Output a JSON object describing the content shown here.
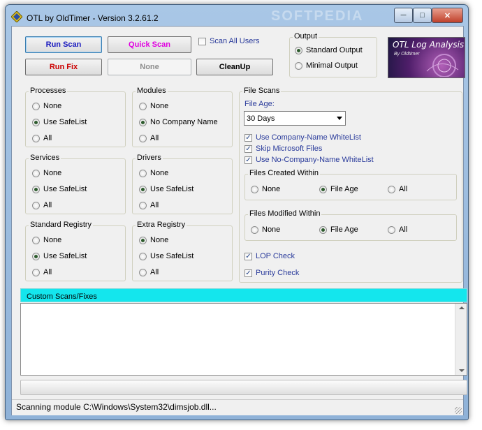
{
  "window": {
    "title": "OTL by OldTimer - Version 3.2.61.2",
    "watermark": "SOFTPEDIA",
    "controls": {
      "minimize": "─",
      "maximize": "□",
      "close": "✕"
    }
  },
  "colors": {
    "blue_text": "#1a1abf",
    "red_text": "#cc0000",
    "magenta_text": "#e000e0",
    "cyan_bar": "#14e6ed",
    "link_blue": "#2a3b9b"
  },
  "toolbar": {
    "run_scan": "Run Scan",
    "quick_scan": "Quick Scan",
    "run_fix": "Run Fix",
    "none": "None",
    "cleanup": "CleanUp",
    "scan_all_users": "Scan All Users"
  },
  "output": {
    "title": "Output",
    "standard": "Standard Output",
    "minimal": "Minimal Output",
    "selected": "Standard Output"
  },
  "logo": {
    "title": "OTL Log Analysis",
    "subtitle": "By Oldtimer"
  },
  "groups": {
    "processes": {
      "title": "Processes",
      "options": [
        "None",
        "Use SafeList",
        "All"
      ],
      "selected": "Use SafeList"
    },
    "modules": {
      "title": "Modules",
      "options": [
        "None",
        "No Company Name",
        "All"
      ],
      "selected": "No Company Name"
    },
    "services": {
      "title": "Services",
      "options": [
        "None",
        "Use SafeList",
        "All"
      ],
      "selected": "Use SafeList"
    },
    "drivers": {
      "title": "Drivers",
      "options": [
        "None",
        "Use SafeList",
        "All"
      ],
      "selected": "Use SafeList"
    },
    "standard_registry": {
      "title": "Standard Registry",
      "options": [
        "None",
        "Use SafeList",
        "All"
      ],
      "selected": "Use SafeList"
    },
    "extra_registry": {
      "title": "Extra Registry",
      "options": [
        "None",
        "Use SafeList",
        "All"
      ],
      "selected": "None"
    }
  },
  "file_scans": {
    "title": "File Scans",
    "file_age_label": "File Age:",
    "file_age_value": "30 Days",
    "checks": [
      {
        "label": "Use Company-Name WhiteList",
        "checked": true
      },
      {
        "label": "Skip Microsoft Files",
        "checked": true
      },
      {
        "label": "Use No-Company-Name WhiteList",
        "checked": true
      }
    ],
    "created_within": {
      "title": "Files Created Within",
      "options": [
        "None",
        "File Age",
        "All"
      ],
      "selected": "File Age"
    },
    "modified_within": {
      "title": "Files Modified Within",
      "options": [
        "None",
        "File Age",
        "All"
      ],
      "selected": "File Age"
    },
    "lop_check": {
      "label": "LOP Check",
      "checked": true
    },
    "purity_check": {
      "label": "Purity Check",
      "checked": true
    }
  },
  "custom": {
    "label": "Custom Scans/Fixes",
    "value": ""
  },
  "status": {
    "text": "Scanning module C:\\Windows\\System32\\dimsjob.dll..."
  }
}
